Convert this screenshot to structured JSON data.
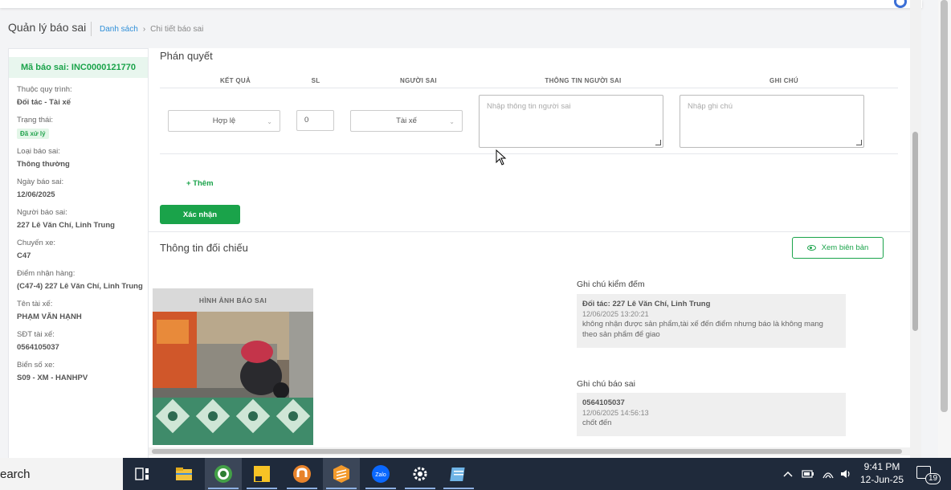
{
  "page": {
    "title": "Quản lý báo sai",
    "breadcrumb": {
      "list": "Danh sách",
      "separator": "›",
      "current": "Chi tiết báo sai"
    }
  },
  "left_panel": {
    "code": "Mã báo sai: INC0000121770",
    "items": [
      {
        "label": "Thuộc quy trình:",
        "value": "Đối tác - Tài xế"
      },
      {
        "label": "Trạng thái:",
        "badge": "Đã xử lý"
      },
      {
        "label": "Loại báo sai:",
        "value": "Thông thường"
      },
      {
        "label": "Ngày báo sai:",
        "value": "12/06/2025"
      },
      {
        "label": "Người báo sai:",
        "value": "227 Lê Văn Chí, Linh Trung"
      },
      {
        "label": "Chuyến xe:",
        "value": "C47"
      },
      {
        "label": "Điểm nhận hàng:",
        "value": "(C47-4) 227 Lê Văn Chí, Linh Trung"
      },
      {
        "label": "Tên tài xế:",
        "value": "PHẠM VĂN HẠNH"
      },
      {
        "label": "SĐT tài xế:",
        "value": "0564105037"
      },
      {
        "label": "Biển số xe:",
        "value": "S09 - XM - HANHPV"
      }
    ]
  },
  "verdict": {
    "title": "Phán quyết",
    "columns": [
      "KẾT QUẢ",
      "SL",
      "NGƯỜI SAI",
      "THÔNG TIN NGƯỜI SAI",
      "GHI CHÚ"
    ],
    "row": {
      "result": "Hợp lệ",
      "quantity": "0",
      "person": "Tài xế",
      "person_info_placeholder": "Nhập thông tin người sai",
      "note_placeholder": "Nhập ghi chú"
    },
    "add_label": "+ Thêm",
    "confirm_label": "Xác nhận"
  },
  "comparison": {
    "title": "Thông tin đối chiếu",
    "view_button": "Xem biên bản",
    "image_header": "HÌNH ẢNH BÁO SAI",
    "count_note": {
      "label": "Ghi chú kiểm đếm",
      "title": "Đối tác: 227 Lê Văn Chí, Linh Trung",
      "time": "12/06/2025 13:20:21",
      "text": "không nhận được sản phẩm,tài xế đến điểm nhưng báo là không mang theo sản phẩm để giao"
    },
    "report_note": {
      "label": "Ghi chú báo sai",
      "title": "0564105037",
      "time": "12/06/2025 14:56:13",
      "text": "chốt đến"
    }
  },
  "taskbar": {
    "search": "earch",
    "time": "9:41 PM",
    "date": "12-Jun-25",
    "notifications": "19"
  },
  "colors": {
    "accent": "#1aa34a",
    "link": "#2f8fd8",
    "taskbar": "#1f2a3b"
  }
}
